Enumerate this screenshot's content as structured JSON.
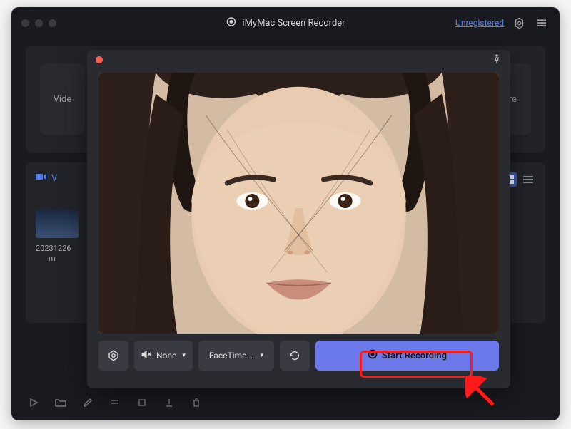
{
  "app": {
    "title": "iMyMac Screen Recorder",
    "unregistered": "Unregistered"
  },
  "mainPanel": {
    "item1": "Vide",
    "item4": "ture"
  },
  "section": {
    "header": "V",
    "thumbLabel1": "20231226",
    "thumbLabel2": "m"
  },
  "modal": {
    "audioLabel": "None",
    "cameraLabel": "FaceTime …",
    "startLabel": "Start Recording"
  }
}
